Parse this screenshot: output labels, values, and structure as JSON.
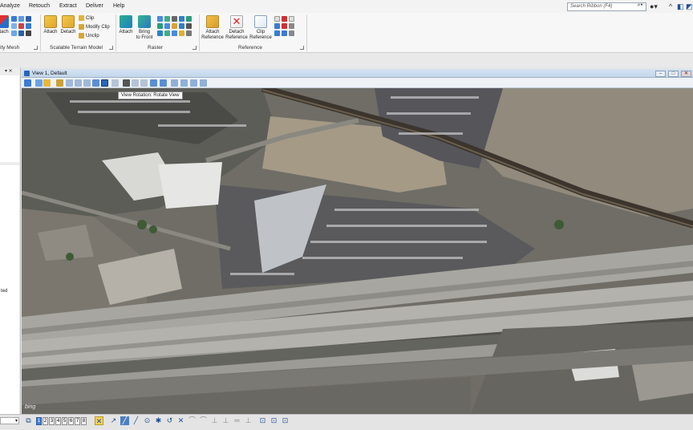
{
  "menu": {
    "tabs": [
      "Analyze",
      "Retouch",
      "Extract",
      "Deliver",
      "Help"
    ],
    "search_placeholder": "Search Ribbon (F4)"
  },
  "ribbon": {
    "groups": {
      "reality_mesh": {
        "label": "ity Mesh",
        "cut_label": "tach"
      },
      "scalable_terrain": {
        "label": "Scalable Terrain Model",
        "attach": "Attach",
        "detach": "Detach",
        "clip": "Clip",
        "modify_clip": "Modify Clip",
        "unclip": "Unclip"
      },
      "raster": {
        "label": "Raster",
        "attach": "Attach",
        "bring_to_front_line1": "Bring",
        "bring_to_front_line2": "to Front"
      },
      "reference": {
        "label": "Reference",
        "attach_ref_line1": "Attach",
        "attach_ref_line2": "Reference",
        "detach_ref_line1": "Detach",
        "detach_ref_line2": "Reference",
        "clip_ref_line1": "Clip",
        "clip_ref_line2": "Reference"
      }
    }
  },
  "left_panel": {
    "partial_text": "ted"
  },
  "view": {
    "title": "View 1, Default",
    "tooltip": "View Rotation: Rotate View",
    "watermark": "bing"
  },
  "bottom": {
    "view_numbers": [
      "1",
      "2",
      "3",
      "4",
      "5",
      "6",
      "7",
      "8"
    ],
    "active_view": "1"
  },
  "colors": {
    "accent": "#2a63b8",
    "title_bar": "#c3d6ea",
    "ribbon_bg": "#f7f7f7"
  }
}
